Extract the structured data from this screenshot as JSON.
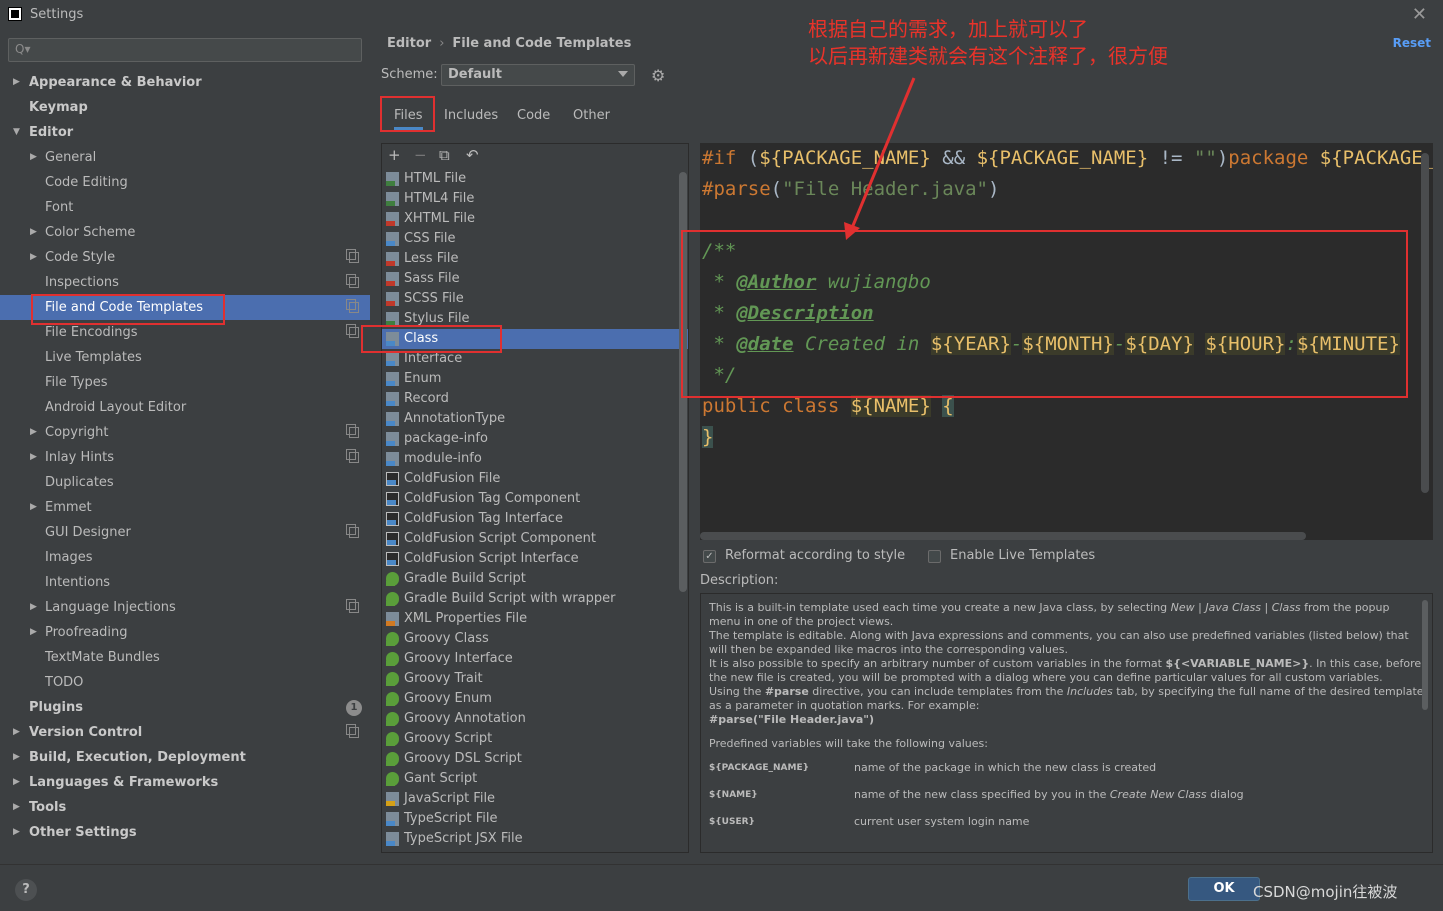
{
  "window": {
    "title": "Settings"
  },
  "search": {
    "placeholder": ""
  },
  "tree": [
    {
      "label": "Appearance & Behavior",
      "level": 0,
      "arrow": "▶",
      "bold": true
    },
    {
      "label": "Keymap",
      "level": 0,
      "arrow": "",
      "bold": true
    },
    {
      "label": "Editor",
      "level": 0,
      "arrow": "▼",
      "bold": true
    },
    {
      "label": "General",
      "level": 1,
      "arrow": "▶"
    },
    {
      "label": "Code Editing",
      "level": 1,
      "arrow": ""
    },
    {
      "label": "Font",
      "level": 1,
      "arrow": ""
    },
    {
      "label": "Color Scheme",
      "level": 1,
      "arrow": "▶"
    },
    {
      "label": "Code Style",
      "level": 1,
      "arrow": "▶",
      "copy": true
    },
    {
      "label": "Inspections",
      "level": 1,
      "arrow": "",
      "copy": true
    },
    {
      "label": "File and Code Templates",
      "level": 1,
      "arrow": "",
      "copy": true,
      "selected": true
    },
    {
      "label": "File Encodings",
      "level": 1,
      "arrow": "",
      "copy": true
    },
    {
      "label": "Live Templates",
      "level": 1,
      "arrow": ""
    },
    {
      "label": "File Types",
      "level": 1,
      "arrow": ""
    },
    {
      "label": "Android Layout Editor",
      "level": 1,
      "arrow": ""
    },
    {
      "label": "Copyright",
      "level": 1,
      "arrow": "▶",
      "copy": true
    },
    {
      "label": "Inlay Hints",
      "level": 1,
      "arrow": "▶",
      "copy": true
    },
    {
      "label": "Duplicates",
      "level": 1,
      "arrow": ""
    },
    {
      "label": "Emmet",
      "level": 1,
      "arrow": "▶"
    },
    {
      "label": "GUI Designer",
      "level": 1,
      "arrow": "",
      "copy": true
    },
    {
      "label": "Images",
      "level": 1,
      "arrow": ""
    },
    {
      "label": "Intentions",
      "level": 1,
      "arrow": ""
    },
    {
      "label": "Language Injections",
      "level": 1,
      "arrow": "▶",
      "copy": true
    },
    {
      "label": "Proofreading",
      "level": 1,
      "arrow": "▶"
    },
    {
      "label": "TextMate Bundles",
      "level": 1,
      "arrow": ""
    },
    {
      "label": "TODO",
      "level": 1,
      "arrow": ""
    },
    {
      "label": "Plugins",
      "level": 0,
      "arrow": "",
      "bold": true,
      "badge": "1"
    },
    {
      "label": "Version Control",
      "level": 0,
      "arrow": "▶",
      "bold": true,
      "copy": true
    },
    {
      "label": "Build, Execution, Deployment",
      "level": 0,
      "arrow": "▶",
      "bold": true
    },
    {
      "label": "Languages & Frameworks",
      "level": 0,
      "arrow": "▶",
      "bold": true
    },
    {
      "label": "Tools",
      "level": 0,
      "arrow": "▶",
      "bold": true
    },
    {
      "label": "Other Settings",
      "level": 0,
      "arrow": "▶",
      "bold": true
    }
  ],
  "breadcrumb": {
    "section": "Editor",
    "separator": "›",
    "page": "File and Code Templates"
  },
  "reset_label": "Reset",
  "scheme": {
    "label": "Scheme:",
    "value": "Default"
  },
  "tabs": [
    "Files",
    "Includes",
    "Code",
    "Other"
  ],
  "toolbar": {
    "add": "+",
    "remove": "−",
    "copy": "⧉",
    "revert": "↶"
  },
  "templates": [
    {
      "name": "HTML File",
      "tag": "#3f7e3f"
    },
    {
      "name": "HTML4 File",
      "tag": "#3f7e3f"
    },
    {
      "name": "XHTML File",
      "tag": "#c0392b"
    },
    {
      "name": "CSS File",
      "tag": "#4a88c7"
    },
    {
      "name": "Less File",
      "tag": "#c0392b"
    },
    {
      "name": "Sass File",
      "tag": "#c0392b"
    },
    {
      "name": "SCSS File",
      "tag": "#c0392b"
    },
    {
      "name": "Stylus File",
      "tag": "#3f7e3f"
    },
    {
      "name": "Class",
      "tag": "#4a88c7",
      "selected": true
    },
    {
      "name": "Interface",
      "tag": "#4a88c7"
    },
    {
      "name": "Enum",
      "tag": "#4a88c7"
    },
    {
      "name": "Record",
      "tag": "#4a88c7"
    },
    {
      "name": "AnnotationType",
      "tag": "#4a88c7"
    },
    {
      "name": "package-info",
      "tag": "#4a88c7"
    },
    {
      "name": "module-info",
      "tag": "#4a88c7"
    },
    {
      "name": "ColdFusion File",
      "tag": "#4a88c7",
      "cf": true
    },
    {
      "name": "ColdFusion Tag Component",
      "tag": "#4a88c7",
      "cf": true
    },
    {
      "name": "ColdFusion Tag Interface",
      "tag": "#4a88c7",
      "cf": true
    },
    {
      "name": "ColdFusion Script Component",
      "tag": "#4a88c7",
      "cf": true
    },
    {
      "name": "ColdFusion Script Interface",
      "tag": "#4a88c7",
      "cf": true
    },
    {
      "name": "Gradle Build Script",
      "tag": "#5a9e3a",
      "round": true
    },
    {
      "name": "Gradle Build Script with wrapper",
      "tag": "#5a9e3a",
      "round": true
    },
    {
      "name": "XML Properties File",
      "tag": "#d17a22"
    },
    {
      "name": "Groovy Class",
      "tag": "#5a9e3a",
      "round": true
    },
    {
      "name": "Groovy Interface",
      "tag": "#5a9e3a",
      "round": true
    },
    {
      "name": "Groovy Trait",
      "tag": "#5a9e3a",
      "round": true
    },
    {
      "name": "Groovy Enum",
      "tag": "#5a9e3a",
      "round": true
    },
    {
      "name": "Groovy Annotation",
      "tag": "#5a9e3a",
      "round": true
    },
    {
      "name": "Groovy Script",
      "tag": "#5a9e3a",
      "round": true
    },
    {
      "name": "Groovy DSL Script",
      "tag": "#5a9e3a",
      "round": true
    },
    {
      "name": "Gant Script",
      "tag": "#5a9e3a",
      "round": true
    },
    {
      "name": "JavaScript File",
      "tag": "#d4a017"
    },
    {
      "name": "TypeScript File",
      "tag": "#4a88c7"
    },
    {
      "name": "TypeScript JSX File",
      "tag": "#4a88c7"
    }
  ],
  "code": {
    "l1": {
      "if": "#if",
      "p1": " (",
      "v1": "${PACKAGE_NAME}",
      "and": " && ",
      "v2": "${PACKAGE_NAME}",
      "ne": " != ",
      "s": "\"\"",
      "p2": ")",
      "pkg": "package ",
      "v3": "${PACKAGE_NAM"
    },
    "l2": {
      "parse": "#parse",
      "p1": "(",
      "s": "\"File Header.java\"",
      "p2": ")"
    },
    "l3": "/**",
    "l4": {
      "star": " * ",
      "tag": "@Author",
      "text": " wujiangbo"
    },
    "l5": {
      "star": " * ",
      "tag": "@Description"
    },
    "l6": {
      "star": " * ",
      "tag": "@date",
      "text": " Created in ",
      "year": "${YEAR}",
      "d1": "-",
      "month": "${MONTH}",
      "d2": "-",
      "day": "${DAY}",
      "sp": " ",
      "hour": "${HOUR}",
      "colon": ":",
      "minute": "${MINUTE}"
    },
    "l7": " */",
    "l8": {
      "kw": "public class ",
      "name": "${NAME}",
      "sp": " ",
      "brace": "{"
    },
    "l9": "}"
  },
  "options": {
    "reformat": "Reformat according to style",
    "reformat_checked": "✓",
    "live": "Enable Live Templates"
  },
  "description": {
    "label": "Description:",
    "p1a": "This is a built-in template used each time you create a new Java class, by selecting ",
    "p1i": "New | Java Class | Class",
    "p1b": " from the popup menu in one of the project views.",
    "p2": "The template is editable. Along with Java expressions and comments, you can also use predefined variables (listed below) that will then be expanded like macros into the corresponding values.",
    "p3a": "It is also possible to specify an arbitrary number of custom variables in the format ",
    "p3b": "${<VARIABLE_NAME>}",
    "p3c": ". In this case, before the new file is created, you will be prompted with a dialog where you can define particular values for all custom variables.",
    "p4a": "Using the ",
    "p4b": "#parse",
    "p4c": " directive, you can include templates from the ",
    "p4i": "Includes",
    "p4d": " tab, by specifying the full name of the desired template as a parameter in quotation marks. For example:",
    "p5": "#parse(\"File Header.java\")",
    "p6": "Predefined variables will take the following values:",
    "vars": [
      {
        "name": "${PACKAGE_NAME}",
        "desc": "name of the package in which the new class is created"
      },
      {
        "name": "${NAME}",
        "desc_a": "name of the new class specified by you in the ",
        "desc_i": "Create New Class",
        "desc_b": " dialog"
      },
      {
        "name": "${USER}",
        "desc": "current user system login name"
      }
    ]
  },
  "buttons": {
    "ok": "OK",
    "help": "?"
  },
  "watermark": "CSDN@mojin往被波",
  "annotation": {
    "line1": "根据自己的需求，加上就可以了",
    "line2": "以后再新建类就会有这个注释了，很方便"
  },
  "colors": {
    "accent": "#4b6eaf",
    "annotation_red": "#e03030"
  }
}
